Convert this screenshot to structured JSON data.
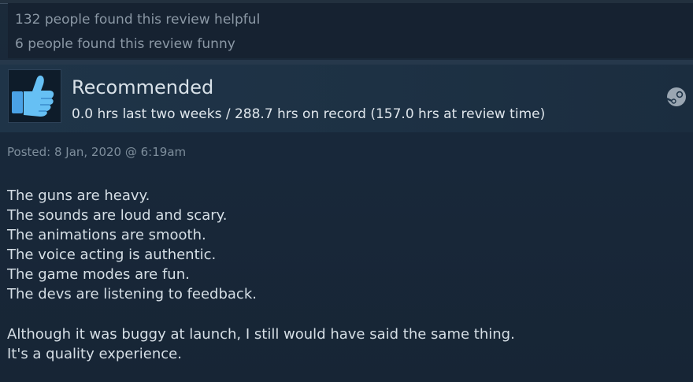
{
  "helpful": {
    "helpful_text": "132 people found this review helpful",
    "funny_text": "6 people found this review funny"
  },
  "review_header": {
    "thumb_icon": "thumbs-up-icon",
    "recommendation": "Recommended",
    "hours_text": "0.0 hrs last two weeks / 288.7 hrs on record (157.0 hrs at review time)",
    "platform_icon": "steam-icon"
  },
  "posted": {
    "text": "Posted: 8 Jan, 2020 @ 6:19am"
  },
  "review_body": {
    "lines": [
      "The guns are heavy.",
      "The sounds are loud and scary.",
      "The animations are smooth.",
      "The voice acting is authentic.",
      "The game modes are fun.",
      "The devs are listening to feedback.",
      "",
      "Although it was buggy at launch, I still would have said the same thing.",
      "It's a quality experience."
    ]
  },
  "colors": {
    "background": "#1b2838",
    "header_band": "#1f3448",
    "thumb_blue": "#66c0f4",
    "text_primary": "#d6dfe6",
    "text_muted": "#8b98a5"
  }
}
